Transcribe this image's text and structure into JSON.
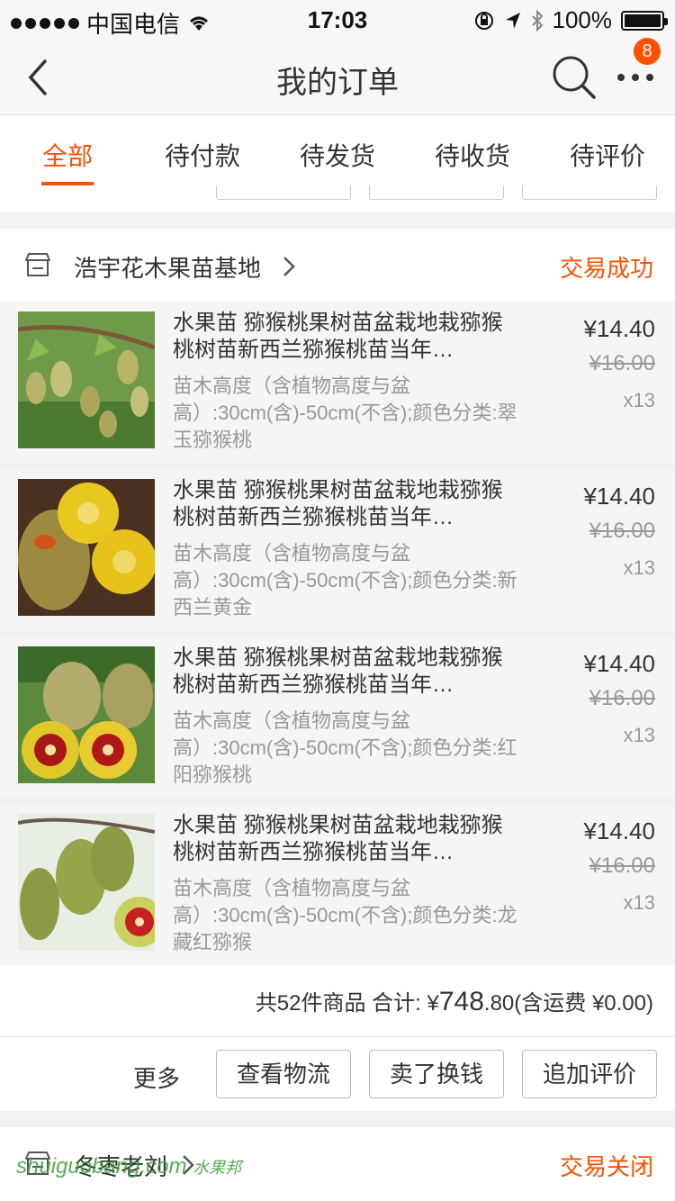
{
  "status_bar": {
    "carrier": "中国电信",
    "time": "17:03",
    "battery": "100%"
  },
  "nav": {
    "title": "我的订单",
    "badge_count": "8"
  },
  "tabs": [
    {
      "label": "全部",
      "active": true
    },
    {
      "label": "待付款"
    },
    {
      "label": "待发货"
    },
    {
      "label": "待收货"
    },
    {
      "label": "待评价"
    }
  ],
  "order": {
    "shop_name": "浩宇花木果苗基地",
    "status": "交易成功",
    "items": [
      {
        "title": "水果苗 猕猴桃果树苗盆栽地栽猕猴桃树苗新西兰猕猴桃苗当年…",
        "sku": "苗木高度（含植物高度与盆高）:30cm(含)-50cm(不含);颜色分类:翠玉猕猴桃",
        "price": "¥14.40",
        "original_price": "¥16.00",
        "quantity": "x13"
      },
      {
        "title": "水果苗 猕猴桃果树苗盆栽地栽猕猴桃树苗新西兰猕猴桃苗当年…",
        "sku": "苗木高度（含植物高度与盆高）:30cm(含)-50cm(不含);颜色分类:新西兰黄金",
        "price": "¥14.40",
        "original_price": "¥16.00",
        "quantity": "x13"
      },
      {
        "title": "水果苗 猕猴桃果树苗盆栽地栽猕猴桃树苗新西兰猕猴桃苗当年…",
        "sku": "苗木高度（含植物高度与盆高）:30cm(含)-50cm(不含);颜色分类:红阳猕猴桃",
        "price": "¥14.40",
        "original_price": "¥16.00",
        "quantity": "x13"
      },
      {
        "title": "水果苗 猕猴桃果树苗盆栽地栽猕猴桃树苗新西兰猕猴桃苗当年…",
        "sku": "苗木高度（含植物高度与盆高）:30cm(含)-50cm(不含);颜色分类:龙藏红猕猴",
        "price": "¥14.40",
        "original_price": "¥16.00",
        "quantity": "x13"
      }
    ],
    "summary_prefix": "共52件商品 合计: ¥",
    "total_int": "748",
    "total_dec": ".80",
    "summary_suffix": "(含运费 ¥0.00)",
    "actions": {
      "more": "更多",
      "logistics": "查看物流",
      "resell": "卖了换钱",
      "review": "追加评价"
    }
  },
  "next_order": {
    "shop_name": "冬枣老刘",
    "status": "交易关闭"
  },
  "watermark": {
    "text": "shuiguobang",
    "suffix": ".com",
    "cn": "水果邦"
  },
  "colors": {
    "accent": "#ff5000",
    "text": "#333333",
    "muted": "#999999"
  }
}
